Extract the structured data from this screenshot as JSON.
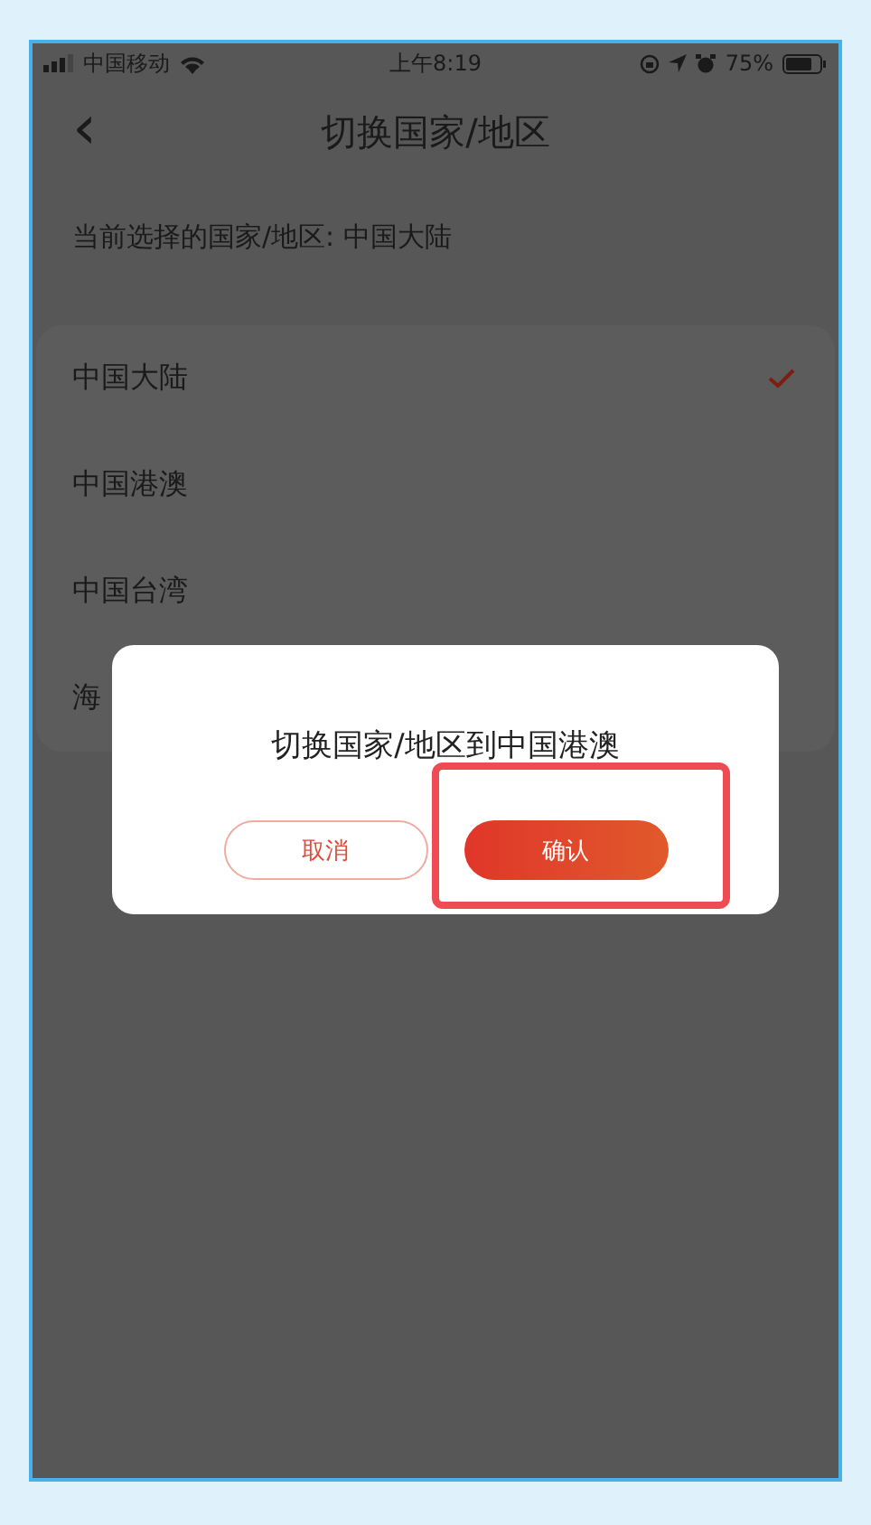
{
  "status_bar": {
    "carrier": "中国移动",
    "time": "上午8:19",
    "battery": "75%"
  },
  "header": {
    "back": "‹",
    "title": "切换国家/地区"
  },
  "current": {
    "text": "当前选择的国家/地区:  中国大陆"
  },
  "regions": [
    {
      "label": "中国大陆",
      "selected": true
    },
    {
      "label": "中国港澳",
      "selected": false
    },
    {
      "label": "中国台湾",
      "selected": false
    },
    {
      "label": "海",
      "selected": false
    }
  ],
  "dialog": {
    "title": "切换国家/地区到中国港澳",
    "buttons": [
      {
        "kind": "cancel",
        "label": "取消"
      },
      {
        "kind": "confirm",
        "label": "确认"
      }
    ]
  }
}
